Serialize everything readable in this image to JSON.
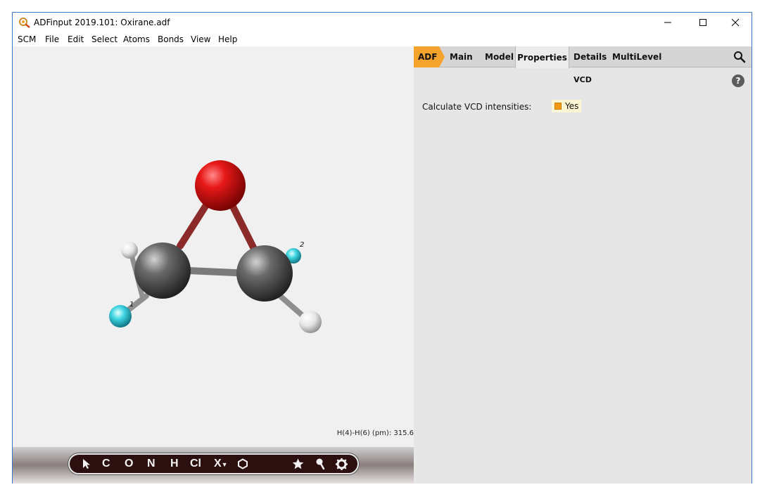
{
  "window": {
    "title": "ADFinput 2019.101: Oxirane.adf"
  },
  "menu": [
    "SCM",
    "File",
    "Edit",
    "Select",
    "Atoms",
    "Bonds",
    "View",
    "Help"
  ],
  "viewport": {
    "atom_labels": [
      "1",
      "2"
    ],
    "measurement": "H(4)-H(6) (pm): 315.6"
  },
  "toolbar": {
    "tools": [
      "C",
      "O",
      "N",
      "H",
      "Cl",
      "X"
    ]
  },
  "tabs": [
    "ADF",
    "Main",
    "Model",
    "Properties",
    "Details",
    "MultiLevel"
  ],
  "active_tab": "Properties",
  "panel": {
    "section_title": "VCD",
    "help_label": "?",
    "field_label": "Calculate VCD intensities:",
    "checkbox_label": "Yes",
    "checkbox_checked": true
  },
  "colors": {
    "accent": "#f4a32c",
    "oxygen": "#e81818",
    "carbon": "#555555",
    "hydrogen": "#f2f2f2",
    "selected": "#38d3e0"
  }
}
